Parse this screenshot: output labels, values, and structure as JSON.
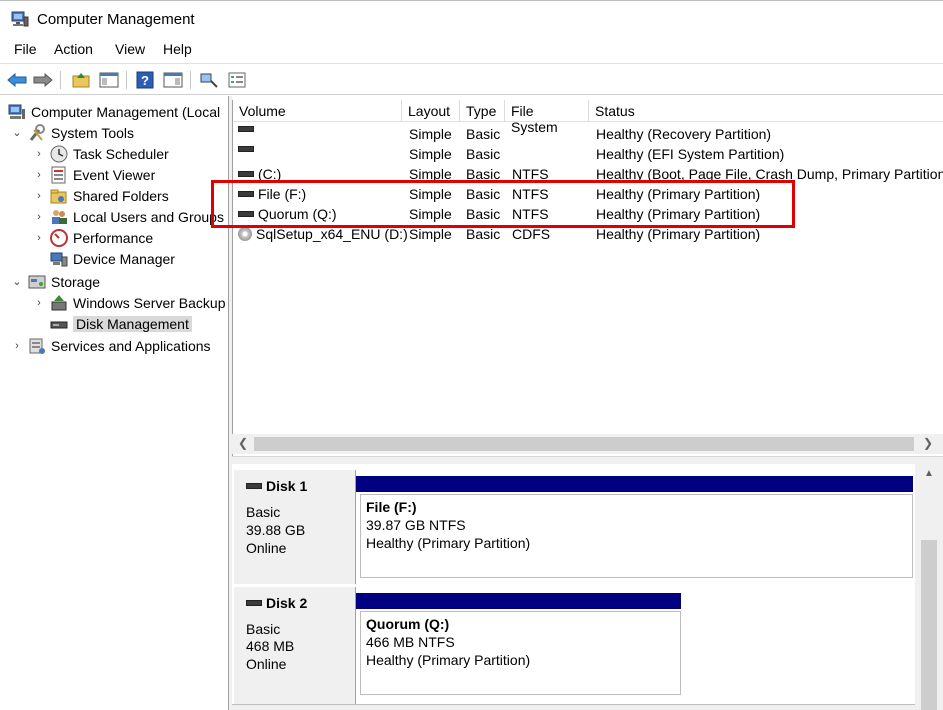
{
  "window": {
    "title": "Computer Management"
  },
  "menu": [
    "File",
    "Action",
    "View",
    "Help"
  ],
  "toolbar": {
    "icons": [
      "back-arrow-icon",
      "forward-arrow-icon",
      "up-folder-icon",
      "show-hide-tree-icon",
      "help-icon",
      "show-hide-action-pane-icon",
      "connect-icon",
      "properties-icon"
    ]
  },
  "tree": {
    "root": "Computer Management (Local",
    "system_tools": "System Tools",
    "task_scheduler": "Task Scheduler",
    "event_viewer": "Event Viewer",
    "shared_folders": "Shared Folders",
    "local_users": "Local Users and Groups",
    "performance": "Performance",
    "device_manager": "Device Manager",
    "storage": "Storage",
    "wsb": "Windows Server Backup",
    "disk_mgmt": "Disk Management",
    "services": "Services and Applications"
  },
  "volume_list": {
    "columns": [
      "Volume",
      "Layout",
      "Type",
      "File System",
      "Status"
    ],
    "rows": [
      {
        "volume": "",
        "layout": "Simple",
        "type": "Basic",
        "fs": "",
        "status": "Healthy (Recovery Partition)"
      },
      {
        "volume": "",
        "layout": "Simple",
        "type": "Basic",
        "fs": "",
        "status": "Healthy (EFI System Partition)"
      },
      {
        "volume": "(C:)",
        "layout": "Simple",
        "type": "Basic",
        "fs": "NTFS",
        "status": "Healthy (Boot, Page File, Crash Dump, Primary Partition"
      },
      {
        "volume": "File (F:)",
        "layout": "Simple",
        "type": "Basic",
        "fs": "NTFS",
        "status": "Healthy (Primary Partition)"
      },
      {
        "volume": "Quorum (Q:)",
        "layout": "Simple",
        "type": "Basic",
        "fs": "NTFS",
        "status": "Healthy (Primary Partition)"
      },
      {
        "volume": "SqlSetup_x64_ENU (D:)",
        "layout": "Simple",
        "type": "Basic",
        "fs": "CDFS",
        "status": "Healthy (Primary Partition)"
      }
    ]
  },
  "disks": [
    {
      "name": "Disk 1",
      "type": "Basic",
      "size": "39.88 GB",
      "state": "Online",
      "partition": {
        "name": "File  (F:)",
        "size": "39.87 GB NTFS",
        "status": "Healthy (Primary Partition)"
      }
    },
    {
      "name": "Disk 2",
      "type": "Basic",
      "size": "468 MB",
      "state": "Online",
      "partition": {
        "name": "Quorum  (Q:)",
        "size": "466 MB NTFS",
        "status": "Healthy (Primary Partition)"
      }
    }
  ],
  "colors": {
    "partition_bar": "#000080",
    "highlight": "#e00000",
    "selection": "#d9d9d9"
  }
}
